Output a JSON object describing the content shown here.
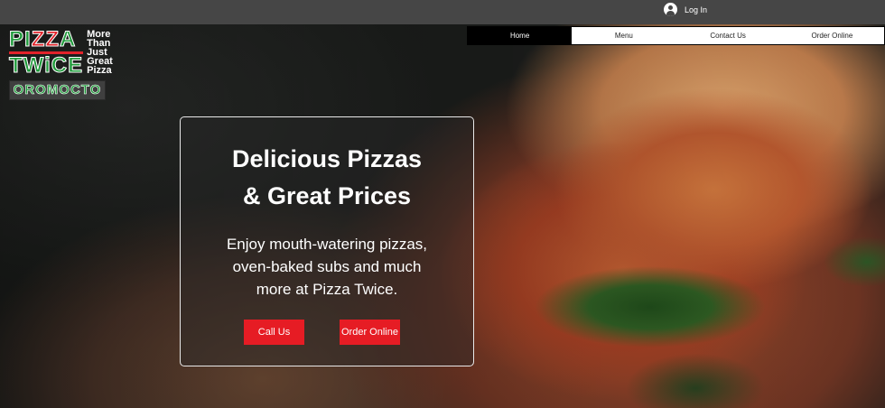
{
  "topbar": {
    "login_label": "Log In"
  },
  "nav": {
    "items": [
      "Home",
      "Menu",
      "Contact Us",
      "Order Online"
    ],
    "active": "Home"
  },
  "logo": {
    "brand_line1": "PIZZA",
    "brand_line2": "TWiCE",
    "tagline": [
      "More",
      "Than",
      "Just",
      "Great",
      "Pizza"
    ],
    "location": "OROMOCTO"
  },
  "hero": {
    "headline_line1": "Delicious Pizzas",
    "headline_line2": "& Great Prices",
    "subtext_line1": "Enjoy mouth-watering pizzas,",
    "subtext_line2": "oven-baked subs and much",
    "subtext_line3": "more at Pizza Twice.",
    "call_button": "Call Us",
    "order_button": "Order Online"
  },
  "colors": {
    "accent_red": "#e61c24",
    "brand_green": "#1e9a3a",
    "topbar": "#464646"
  },
  "icons": {
    "login": "user-avatar-icon"
  }
}
